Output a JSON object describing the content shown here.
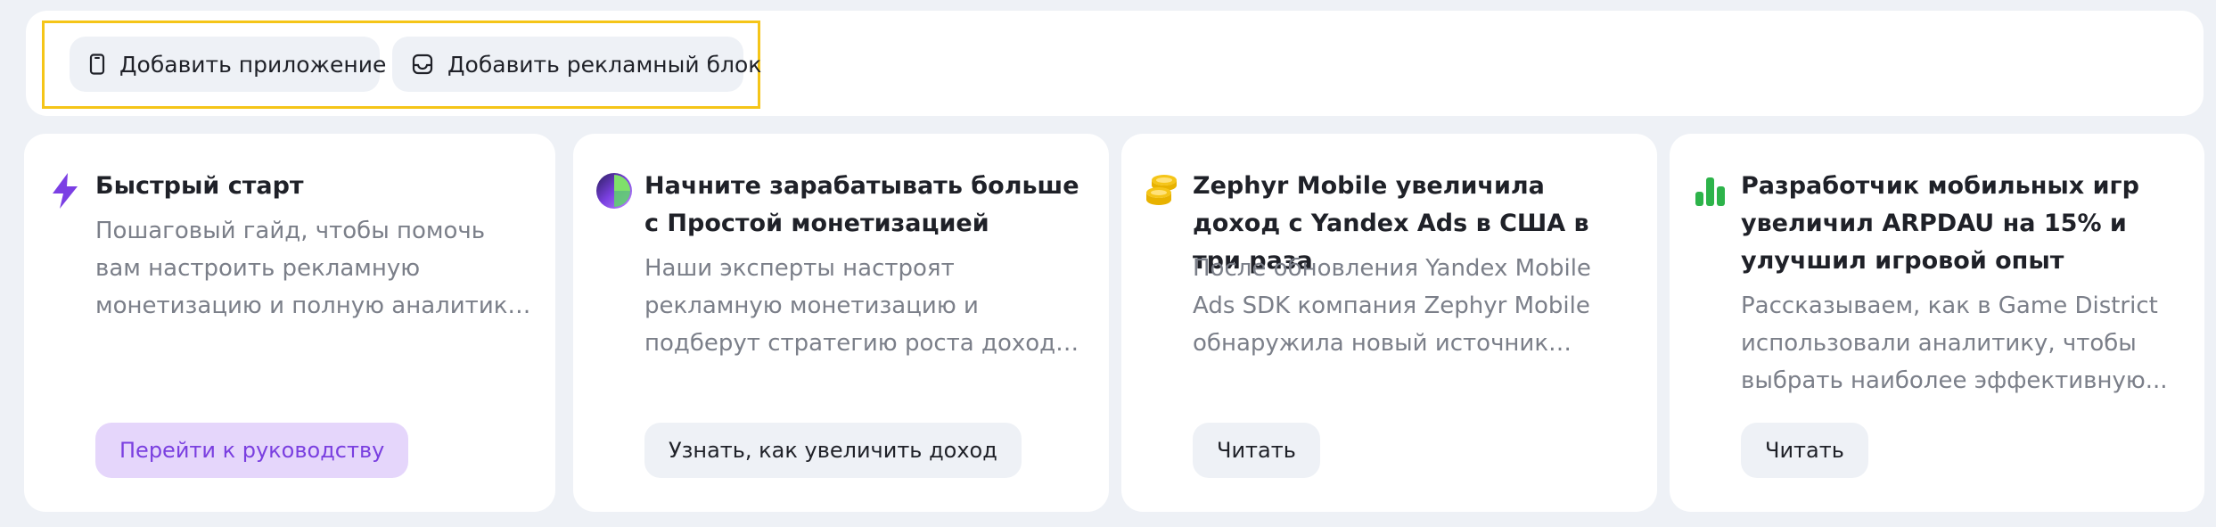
{
  "toolbar": {
    "add_app_label": "Добавить приложение",
    "add_block_label": "Добавить рекламный блок",
    "add_app_icon": "phone-icon",
    "add_block_icon": "ad-block-icon"
  },
  "cards": [
    {
      "icon": "lightning-icon",
      "title": "Быстрый старт",
      "description": "Пошаговый гайд, чтобы помочь вам настроить рекламную монетизацию и полную аналитику приложения.",
      "button": "Перейти к руководству"
    },
    {
      "icon": "monetization-logo-icon",
      "title": "Начните зарабатывать больше с Простой монетизацией",
      "description": "Наши эксперты настроят рекламную монетизацию и подберут стратегию роста дохода для вашего...",
      "button": "Узнать, как увеличить доход"
    },
    {
      "icon": "coins-icon",
      "title": "Zephyr Mobile увеличила доход с Yandex Ads в США в три раза",
      "description": "После обновления Yandex Mobile Ads SDK компания Zephyr Mobile обнаружила новый источник доход...",
      "button": "Читать"
    },
    {
      "icon": "bar-chart-icon",
      "title": "Разработчик мобильных игр увеличил ARPDAU на 15% и улучшил игровой опыт",
      "description": "Рассказываем, как в Game District использовали аналитику, чтобы выбрать наиболее эффективную...",
      "button": "Читать"
    }
  ],
  "colors": {
    "page_bg": "#eef1f6",
    "highlight": "#f5c518",
    "primary_button_bg": "#e5d6fb",
    "primary_button_text": "#7a3fe0",
    "lightning": "#7b3fe4",
    "coins": "#f5c518",
    "chart": "#2db34a"
  }
}
